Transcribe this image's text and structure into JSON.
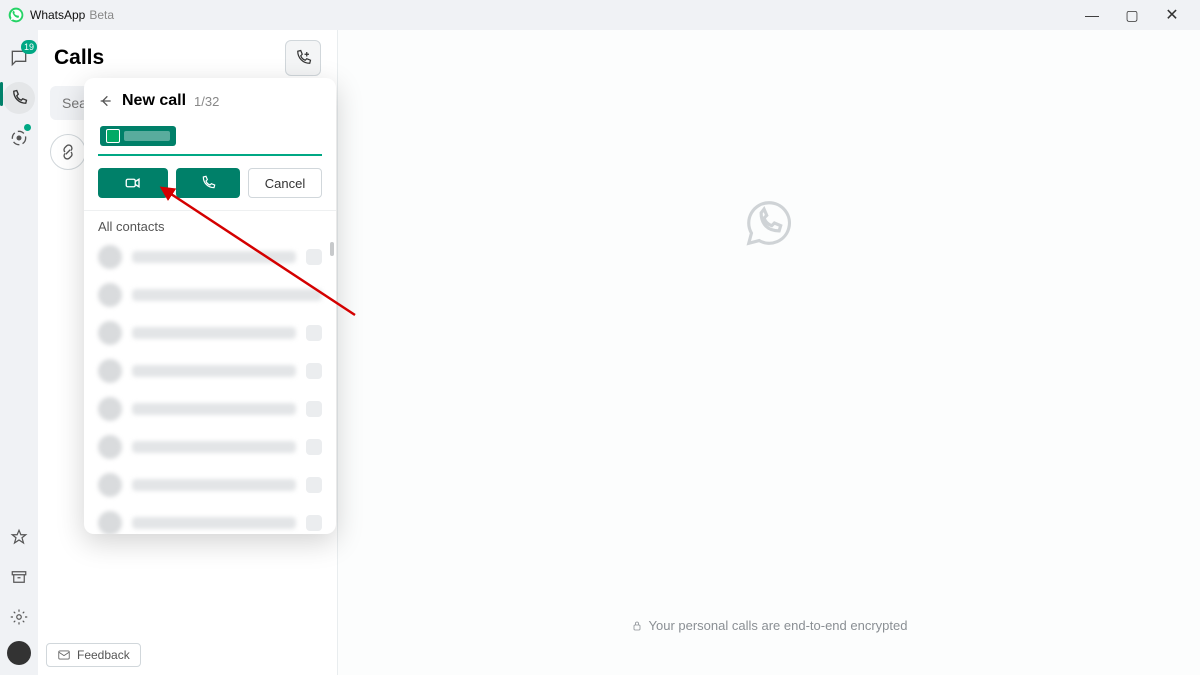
{
  "titlebar": {
    "app_name": "WhatsApp",
    "app_variant": "Beta"
  },
  "rail": {
    "chats_badge": "19"
  },
  "left_panel": {
    "title": "Calls",
    "search_placeholder": "Search or start a new call",
    "feedback_label": "Feedback"
  },
  "flyout": {
    "title": "New call",
    "count": "1/32",
    "cancel_label": "Cancel",
    "section_label": "All contacts"
  },
  "right": {
    "encryption_text": "Your personal calls are end-to-end encrypted"
  }
}
